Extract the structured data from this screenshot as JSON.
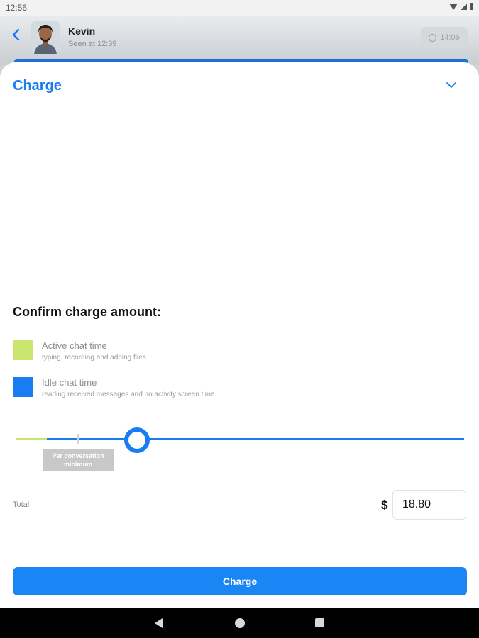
{
  "status_bar": {
    "time": "12:56"
  },
  "chat_header": {
    "contact_name": "Kevin",
    "contact_status": "Seen at 12:39",
    "timer": "14:06"
  },
  "sheet": {
    "title": "Charge",
    "confirm_heading": "Confirm charge amount:",
    "legend": [
      {
        "title": "Active chat time",
        "description": "typing, recording and adding files",
        "color": "#c9e56f"
      },
      {
        "title": "Idle chat time",
        "description": "reading received messages and no activity screen time",
        "color": "#1a7cf2"
      }
    ],
    "slider": {
      "active_fraction": 0.07,
      "minimum_fraction": 0.14,
      "value_fraction": 0.27,
      "minimum_tooltip": "Per conversation minimum"
    },
    "total_label": "Total",
    "currency_symbol": "$",
    "amount": "18.80",
    "charge_button": "Charge"
  },
  "colors": {
    "accent": "#1a7cf2",
    "active": "#c9e56f",
    "button": "#1a86f5"
  },
  "nav_bar": {
    "icons": [
      "back-icon",
      "home-icon",
      "recents-icon"
    ]
  }
}
